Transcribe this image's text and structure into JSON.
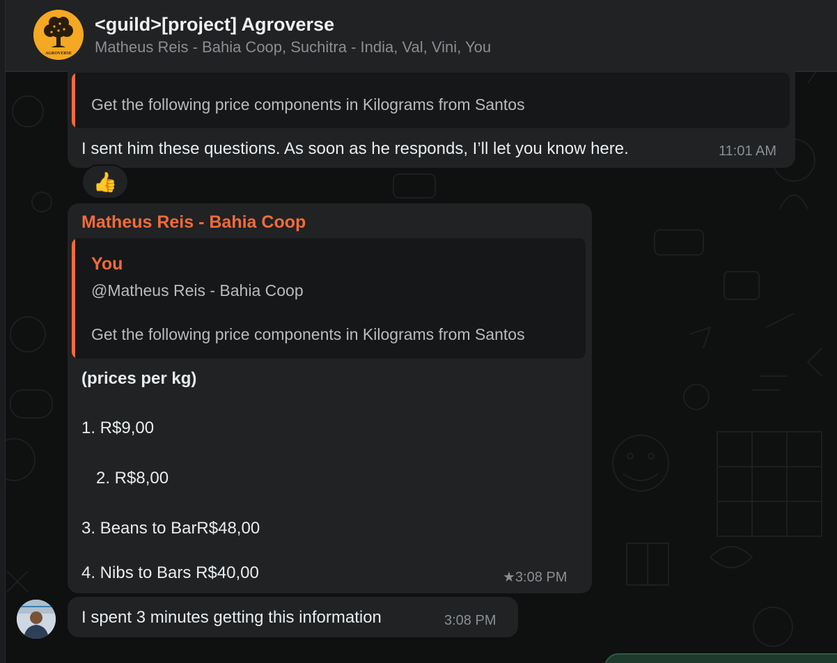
{
  "header": {
    "title": "<guild>[project] Agroverse",
    "members": "Matheus Reis - Bahia Coop, Suchitra - India, Val, Vini, You",
    "avatar_text": "AGROVERSE"
  },
  "messages": {
    "top_quote_text": "Get the following price components in Kilograms from Santos",
    "top_text": "I sent him these questions. As soon as he responds, I’ll let you know here.",
    "top_time": "11:01 AM",
    "reaction": "👍",
    "reply": {
      "sender": "Matheus Reis - Bahia Coop",
      "quote_sender": "You",
      "quote_mention": "@Matheus Reis - Bahia Coop",
      "quote_text": "Get the following price components in Kilograms from Santos",
      "heading": "(prices per kg)",
      "item1": "1. R$9,00",
      "item2": "2.  R$8,00",
      "item3": "3. Beans to BarR$48,00",
      "item4": "4. Nibs to Bars R$40,00",
      "time": "★3:08 PM"
    },
    "last": {
      "text": "I spent 3 minutes getting this information",
      "time": "3:08 PM"
    }
  },
  "colors": {
    "accent": "#f26b3a",
    "bubble": "#202224",
    "background": "#0f1010",
    "avatar_bg": "#f4a823"
  }
}
